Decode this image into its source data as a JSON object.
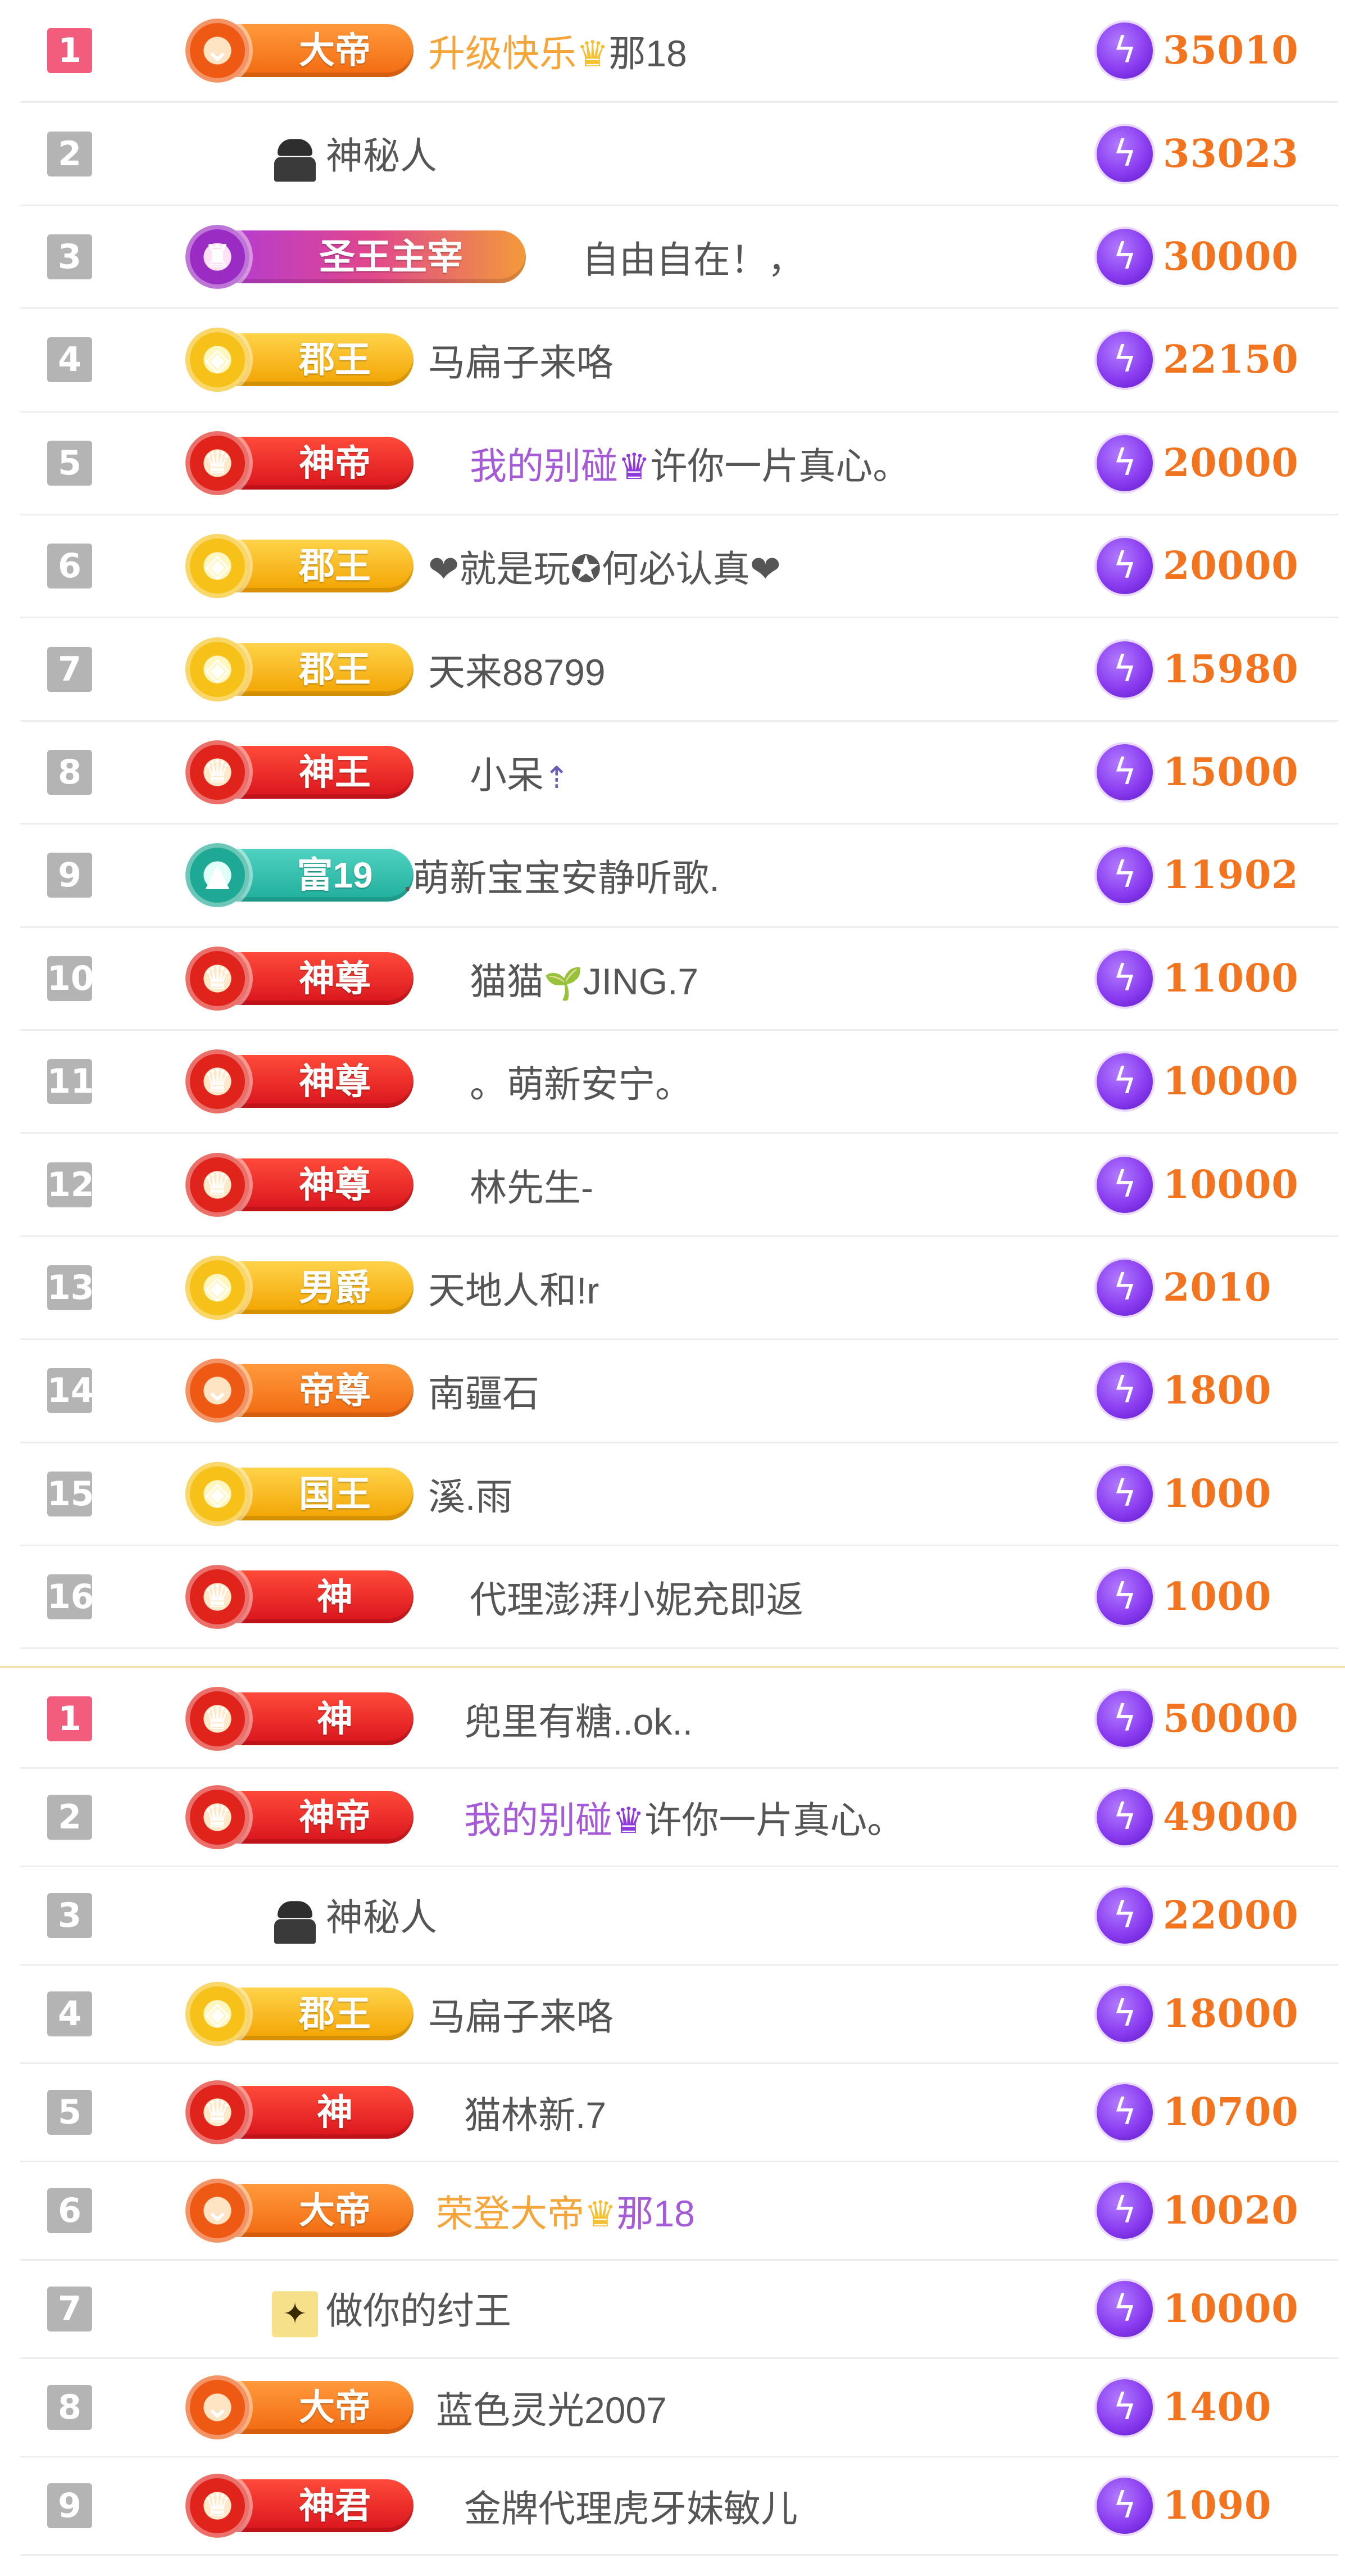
{
  "colors": {
    "rank_top": "#f25d7e",
    "rank_default": "#b4b4b4",
    "score": "#f2741f",
    "bolt": "#8a3df0",
    "name_accent_orange": "#f6a53a",
    "name_accent_purple": "#a55ad6"
  },
  "icons": {
    "score_icon": "lightning-bolt-icon",
    "crown_icon": "crown-icon",
    "anonymous_icon": "spy-avatar-icon"
  },
  "board_a": {
    "rows": [
      {
        "rank": "1",
        "badge": "大帝",
        "badge_style": "orange",
        "name_parts": [
          {
            "t": "升级快乐",
            "c": "accent"
          },
          {
            "t": "♛",
            "c": "crown"
          },
          {
            "t": "那18",
            "c": ""
          }
        ],
        "score": "35010"
      },
      {
        "rank": "2",
        "badge": "",
        "badge_style": "none",
        "avatar": "spy",
        "name_parts": [
          {
            "t": "神秘人",
            "c": ""
          }
        ],
        "score": "33023"
      },
      {
        "rank": "3",
        "badge": "圣王主宰",
        "badge_style": "royal",
        "name_parts": [
          {
            "t": "自由自在！，",
            "c": ""
          }
        ],
        "score": "30000"
      },
      {
        "rank": "4",
        "badge": "郡王",
        "badge_style": "gold",
        "name_parts": [
          {
            "t": "马扁子来咯",
            "c": ""
          }
        ],
        "score": "22150"
      },
      {
        "rank": "5",
        "badge": "神帝",
        "badge_style": "red",
        "name_parts": [
          {
            "t": "我的别碰",
            "c": "purple"
          },
          {
            "t": "♛",
            "c": "crown purple"
          },
          {
            "t": "许你一片真心。",
            "c": ""
          }
        ],
        "score": "20000"
      },
      {
        "rank": "6",
        "badge": "郡王",
        "badge_style": "gold",
        "name_parts": [
          {
            "t": "❤就是玩✪何必认真❤",
            "c": ""
          }
        ],
        "score": "20000"
      },
      {
        "rank": "7",
        "badge": "郡王",
        "badge_style": "gold",
        "name_parts": [
          {
            "t": "天来88799",
            "c": ""
          }
        ],
        "score": "15980"
      },
      {
        "rank": "8",
        "badge": "神王",
        "badge_style": "red",
        "name_parts": [
          {
            "t": "小呆",
            "c": ""
          },
          {
            "t": " ⇡",
            "c": "top"
          }
        ],
        "score": "15000"
      },
      {
        "rank": "9",
        "badge": "富19",
        "badge_style": "teal",
        "name_parts": [
          {
            "t": ".萌新宝宝安静听歌.",
            "c": ""
          }
        ],
        "score": "11902"
      },
      {
        "rank": "10",
        "badge": "神尊",
        "badge_style": "red",
        "name_parts": [
          {
            "t": "猫猫",
            "c": ""
          },
          {
            "t": "🌱",
            "c": "sprout"
          },
          {
            "t": "JING.7",
            "c": ""
          }
        ],
        "score": "11000"
      },
      {
        "rank": "11",
        "badge": "神尊",
        "badge_style": "red",
        "name_parts": [
          {
            "t": "。萌新安宁。",
            "c": ""
          }
        ],
        "score": "10000"
      },
      {
        "rank": "12",
        "badge": "神尊",
        "badge_style": "red",
        "name_parts": [
          {
            "t": "林先生-",
            "c": ""
          }
        ],
        "score": "10000"
      },
      {
        "rank": "13",
        "badge": "男爵",
        "badge_style": "gold",
        "name_parts": [
          {
            "t": "天地人和!r",
            "c": ""
          }
        ],
        "score": "2010"
      },
      {
        "rank": "14",
        "badge": "帝尊",
        "badge_style": "orange",
        "name_parts": [
          {
            "t": "南疆石",
            "c": ""
          }
        ],
        "score": "1800"
      },
      {
        "rank": "15",
        "badge": "国王",
        "badge_style": "gold",
        "name_parts": [
          {
            "t": "溪.雨",
            "c": ""
          }
        ],
        "score": "1000"
      },
      {
        "rank": "16",
        "badge": "神",
        "badge_style": "red",
        "name_parts": [
          {
            "t": "代理澎湃小妮充即返",
            "c": ""
          }
        ],
        "score": "1000"
      }
    ]
  },
  "board_b": {
    "rows": [
      {
        "rank": "1",
        "badge": "神",
        "badge_style": "red",
        "name_parts": [
          {
            "t": "兜里有糖..ok..",
            "c": ""
          }
        ],
        "score": "50000"
      },
      {
        "rank": "2",
        "badge": "神帝",
        "badge_style": "red",
        "name_parts": [
          {
            "t": "我的别碰",
            "c": "purple"
          },
          {
            "t": "♛",
            "c": "crown purple"
          },
          {
            "t": "许你一片真心。",
            "c": ""
          }
        ],
        "score": "49000"
      },
      {
        "rank": "3",
        "badge": "",
        "badge_style": "none",
        "avatar": "spy",
        "name_parts": [
          {
            "t": "神秘人",
            "c": ""
          }
        ],
        "score": "22000"
      },
      {
        "rank": "4",
        "badge": "郡王",
        "badge_style": "gold",
        "name_parts": [
          {
            "t": "马扁子来咯",
            "c": ""
          }
        ],
        "score": "18000"
      },
      {
        "rank": "5",
        "badge": "神",
        "badge_style": "red",
        "name_parts": [
          {
            "t": "猫林新.7",
            "c": ""
          }
        ],
        "score": "10700"
      },
      {
        "rank": "6",
        "badge": "大帝",
        "badge_style": "orange",
        "name_parts": [
          {
            "t": "荣登大帝",
            "c": "accent"
          },
          {
            "t": "♛",
            "c": "crown"
          },
          {
            "t": "那18",
            "c": "purple"
          }
        ],
        "score": "10020"
      },
      {
        "rank": "7",
        "badge": "",
        "badge_style": "none",
        "avatar": "emblem",
        "name_parts": [
          {
            "t": "做你的纣王",
            "c": ""
          }
        ],
        "score": "10000"
      },
      {
        "rank": "8",
        "badge": "大帝",
        "badge_style": "orange",
        "name_parts": [
          {
            "t": "蓝色灵光2007",
            "c": ""
          }
        ],
        "score": "1400"
      },
      {
        "rank": "9",
        "badge": "神君",
        "badge_style": "red",
        "name_parts": [
          {
            "t": "金牌代理虎牙妹敏儿",
            "c": ""
          }
        ],
        "score": "1090"
      }
    ]
  }
}
